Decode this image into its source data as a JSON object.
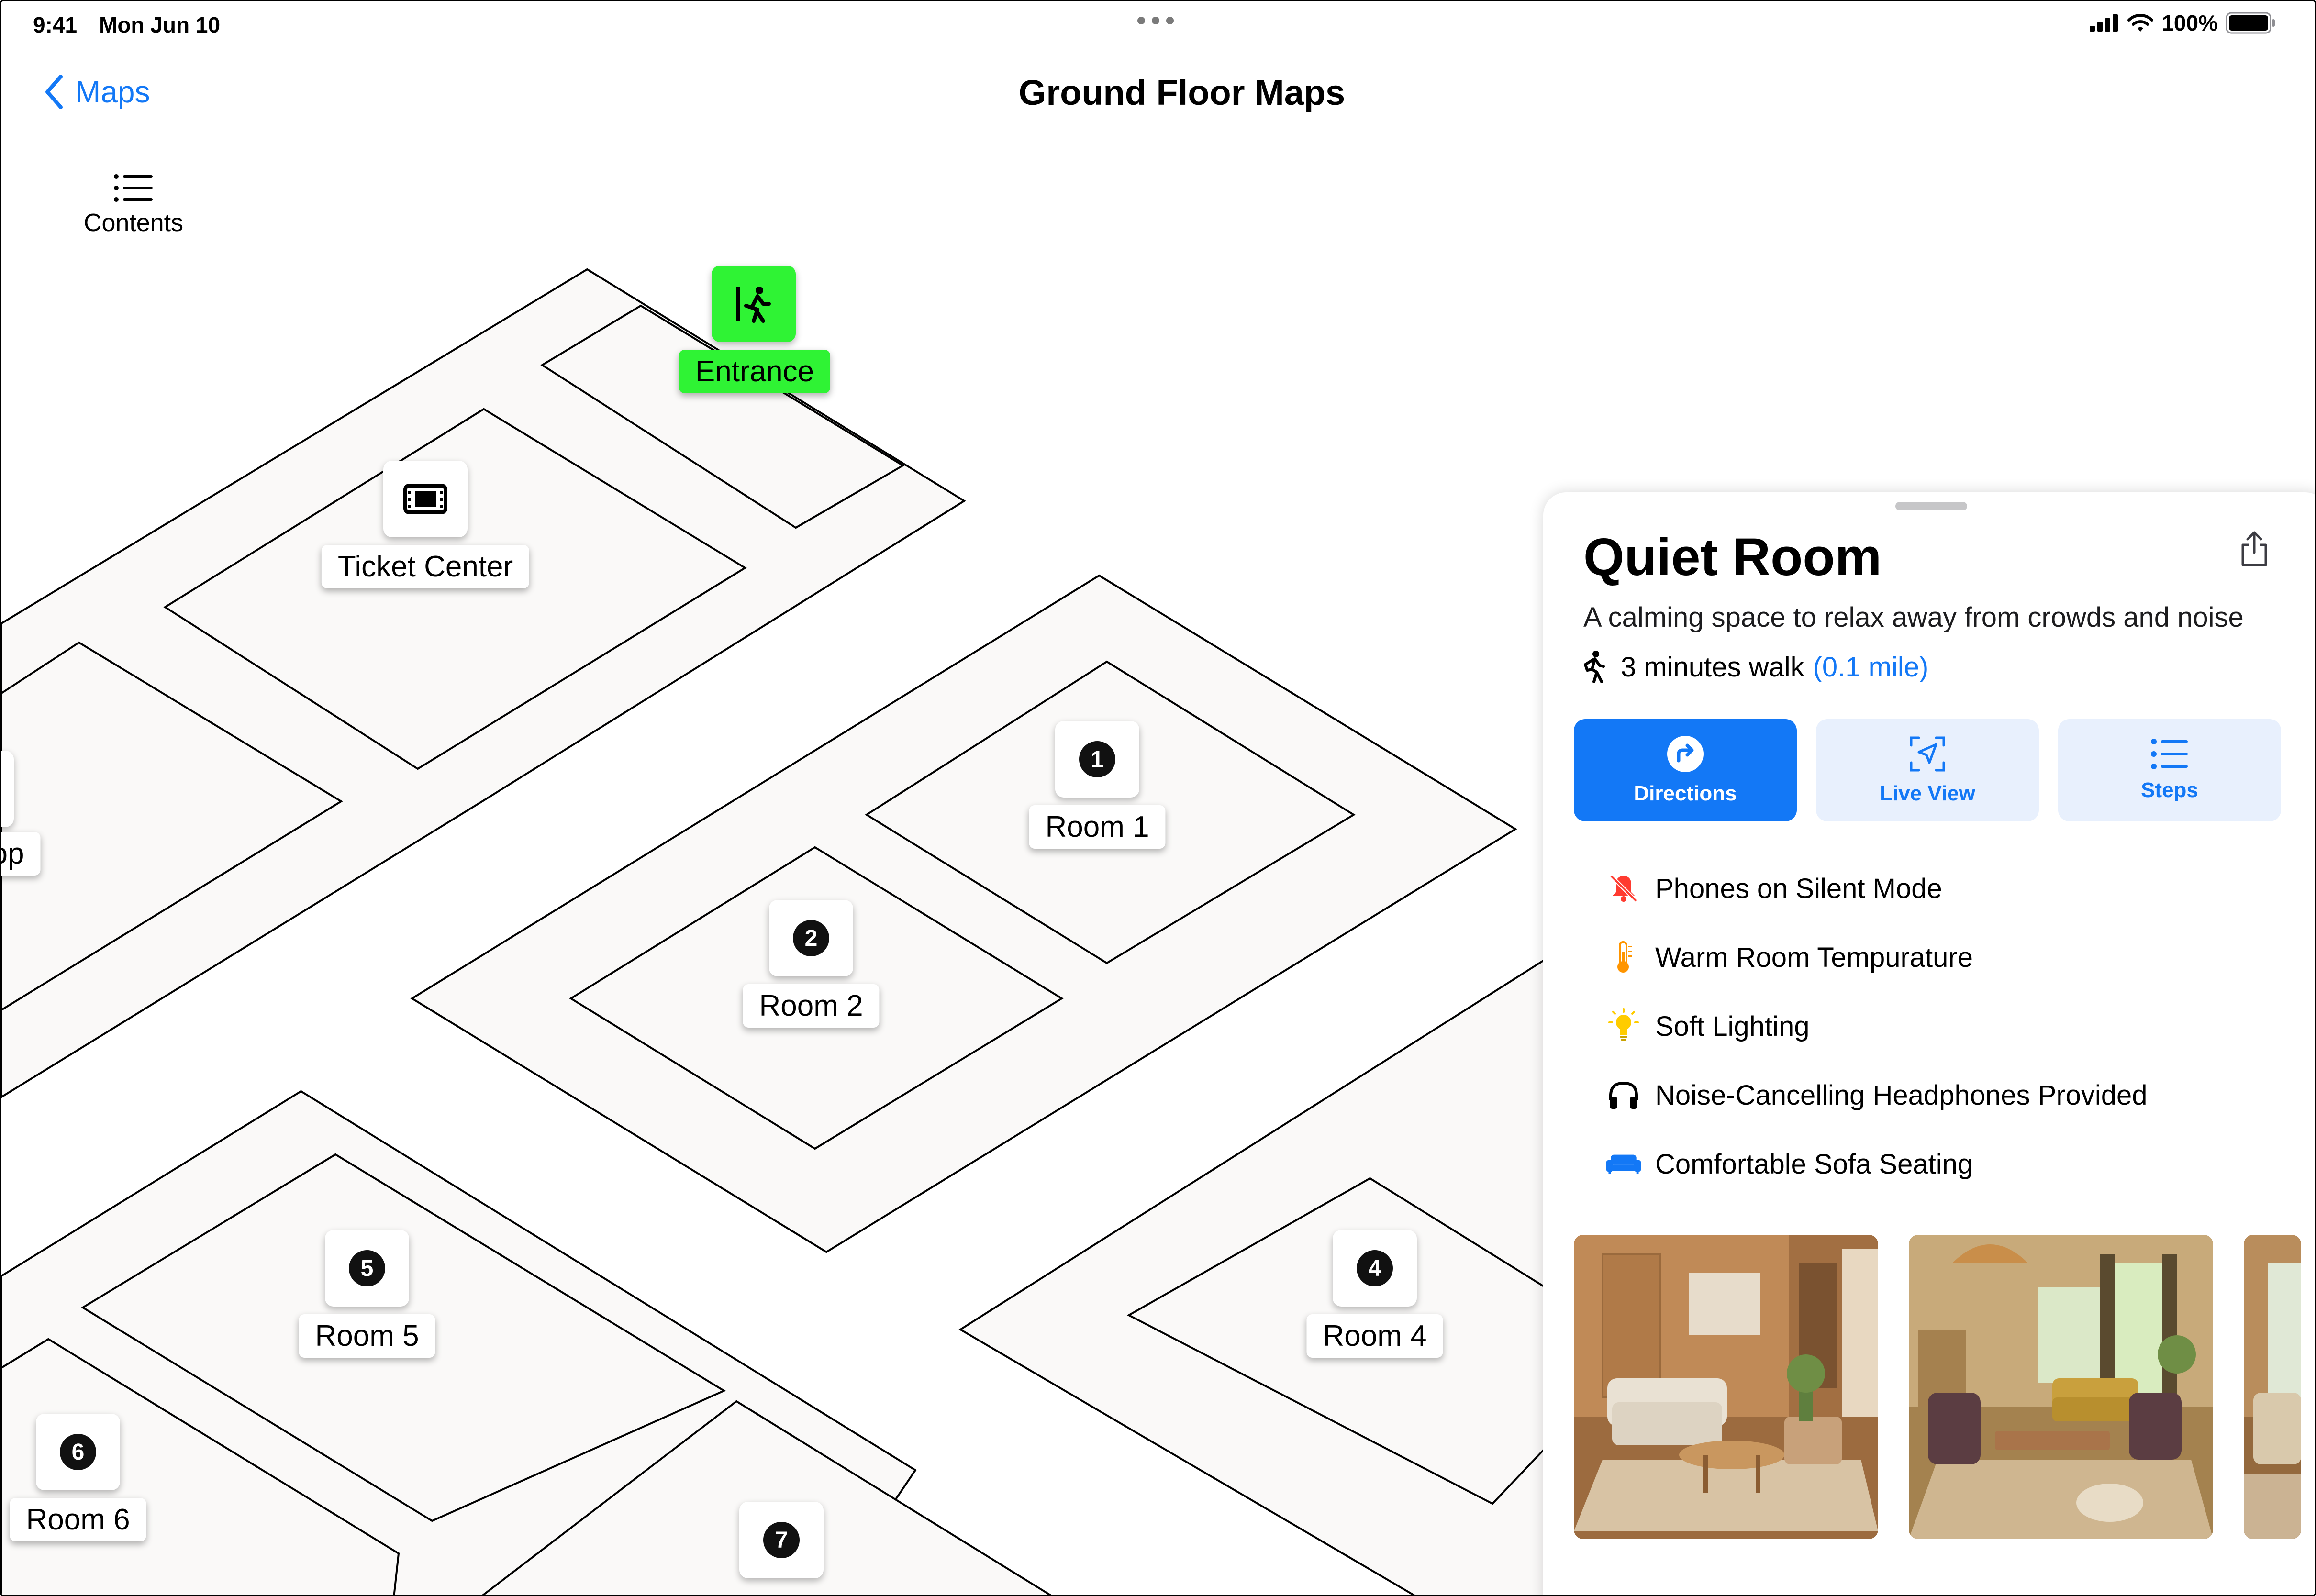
{
  "status_bar": {
    "time": "9:41",
    "date": "Mon Jun 10",
    "battery": "100%"
  },
  "nav": {
    "back_label": "Maps",
    "title": "Ground Floor Maps",
    "contents_label": "Contents"
  },
  "map": {
    "entrance": "Entrance",
    "ticket_center": "Ticket Center",
    "partial_shop": "op",
    "rooms": [
      {
        "num": "1",
        "label": "Room 1"
      },
      {
        "num": "2",
        "label": "Room 2"
      },
      {
        "num": "4",
        "label": "Room 4"
      },
      {
        "num": "5",
        "label": "Room 5"
      },
      {
        "num": "6",
        "label": "Room 6"
      },
      {
        "num": "7",
        "label": ""
      }
    ]
  },
  "panel": {
    "title": "Quiet Room",
    "description": "A calming space to relax away from crowds and noise",
    "walk_time": "3 minutes walk",
    "distance": "(0.1 mile)",
    "actions": [
      {
        "label": "Directions",
        "icon": "directions-icon"
      },
      {
        "label": "Live View",
        "icon": "live-view-icon"
      },
      {
        "label": "Steps",
        "icon": "list-icon"
      }
    ],
    "features": [
      {
        "label": "Phones on Silent Mode",
        "icon": "bell-slash-icon",
        "color": "#ff3b30"
      },
      {
        "label": "Warm Room Tempurature",
        "icon": "thermometer-icon",
        "color": "#ff9500"
      },
      {
        "label": "Soft Lighting",
        "icon": "lightbulb-icon",
        "color": "#ffcc00"
      },
      {
        "label": "Noise-Cancelling Headphones Provided",
        "icon": "headphones-icon",
        "color": "#000000"
      },
      {
        "label": "Comfortable Sofa Seating",
        "icon": "sofa-icon",
        "color": "#1378f6"
      }
    ]
  },
  "colors": {
    "accent": "#1378f6",
    "entrance": "#2ff334",
    "floor": "#faf9f8"
  }
}
